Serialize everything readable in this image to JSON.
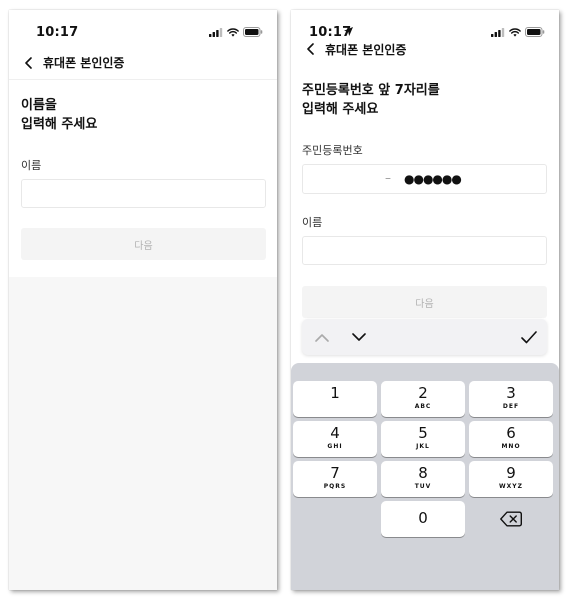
{
  "colors": {
    "background": "#ffffff",
    "disabled_button_bg": "#f4f4f4",
    "disabled_button_text": "#b3b3b3",
    "input_border": "#e8e8e8",
    "keyboard_bg": "#d1d3d9",
    "key_bg": "#ffffff",
    "empty_area": "#f7f7f7"
  },
  "left_screen": {
    "status_bar": {
      "time": "10:17",
      "icons": [
        "cellular-signal-icon",
        "wifi-icon",
        "battery-icon"
      ]
    },
    "nav": {
      "title": "휴대폰 본인인증",
      "back_icon": "chevron-left-icon"
    },
    "heading": {
      "line1": "이름을",
      "line2": "입력해 주세요"
    },
    "name_field": {
      "label": "이름",
      "value": "",
      "placeholder": ""
    },
    "next_button": {
      "label": "다음",
      "enabled": false
    }
  },
  "right_screen": {
    "status_bar": {
      "time": "10:17",
      "icons": [
        "location-arrow-icon",
        "cellular-signal-icon",
        "wifi-icon",
        "battery-icon"
      ]
    },
    "nav": {
      "title": "휴대폰 본인인증",
      "back_icon": "chevron-left-icon"
    },
    "heading": {
      "line1": "주민등록번호 앞 7자리를",
      "line2": "입력해 주세요"
    },
    "rrn_field": {
      "label": "주민등록번호",
      "separator": "–",
      "masked_value": "●●●●●●"
    },
    "name_field": {
      "label": "이름",
      "value": "",
      "placeholder": ""
    },
    "next_button": {
      "label": "다음",
      "enabled": false
    },
    "keyboard_toolbar": {
      "icons": [
        "chevron-up-icon",
        "chevron-down-icon",
        "checkmark-icon"
      ]
    },
    "keypad": {
      "keys": [
        {
          "digit": "1",
          "letters": ""
        },
        {
          "digit": "2",
          "letters": "ABC"
        },
        {
          "digit": "3",
          "letters": "DEF"
        },
        {
          "digit": "4",
          "letters": "GHI"
        },
        {
          "digit": "5",
          "letters": "JKL"
        },
        {
          "digit": "6",
          "letters": "MNO"
        },
        {
          "digit": "7",
          "letters": "PQRS"
        },
        {
          "digit": "8",
          "letters": "TUV"
        },
        {
          "digit": "9",
          "letters": "WXYZ"
        }
      ],
      "zero": {
        "digit": "0"
      },
      "delete_icon": "backspace-icon"
    }
  }
}
